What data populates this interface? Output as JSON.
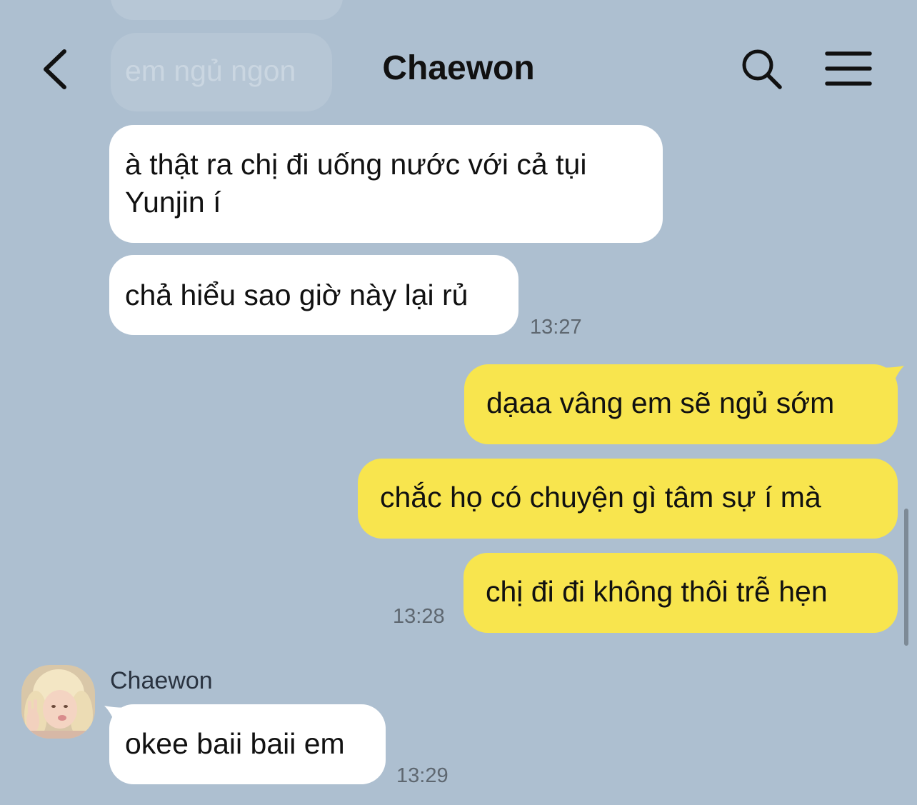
{
  "header": {
    "title": "Chaewon",
    "back_icon": "chevron-left-icon",
    "search_icon": "search-icon",
    "menu_icon": "hamburger-menu-icon"
  },
  "faded_message": {
    "text": "em ngủ ngon"
  },
  "messages": [
    {
      "side": "incoming",
      "text": "à thật ra chị đi uống nước với cả tụi Yunjin í"
    },
    {
      "side": "incoming",
      "text": "chả hiểu sao giờ này lại rủ",
      "time": "13:27"
    },
    {
      "side": "outgoing",
      "text": "dạaa vâng em sẽ ngủ sớm"
    },
    {
      "side": "outgoing",
      "text": "chắc họ có chuyện gì tâm sự í mà"
    },
    {
      "side": "outgoing",
      "text": "chị đi đi không thôi trễ hẹn",
      "time": "13:28"
    },
    {
      "side": "incoming",
      "sender": "Chaewon",
      "text": "okee baii baii em",
      "time": "13:29"
    }
  ],
  "colors": {
    "background": "#adbfd0",
    "incoming_bubble": "#ffffff",
    "outgoing_bubble": "#f8e54e",
    "timestamp": "#5e6770"
  }
}
